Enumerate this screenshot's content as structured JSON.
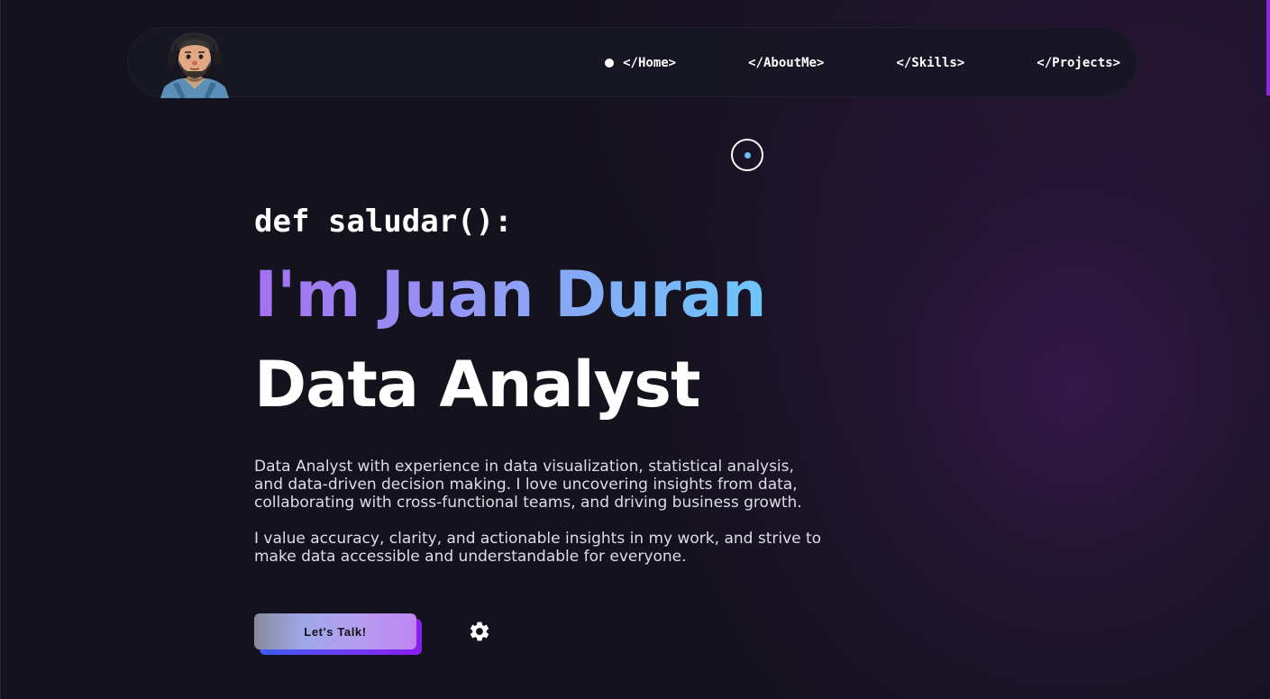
{
  "nav": {
    "items": [
      {
        "label": "</Home>",
        "active": true
      },
      {
        "label": "</AboutMe>",
        "active": false
      },
      {
        "label": "</Skills>",
        "active": false
      },
      {
        "label": "</Projects>",
        "active": false
      }
    ],
    "avatar_icon": "avatar-icon"
  },
  "hero": {
    "greeting": "def saludar():",
    "name": "I'm Juan Duran",
    "role": "Data Analyst",
    "description_1": "Data Analyst with experience in data visualization, statistical analysis, and data-driven decision making. I love uncovering insights from data, collaborating with cross-functional teams, and driving business growth.",
    "description_2": "I value accuracy, clarity, and actionable insights in my work, and strive to make data accessible and understandable for everyone.",
    "cta_label": "Let's Talk!",
    "settings_icon": "gear-icon"
  },
  "colors": {
    "background": "#14121d",
    "navbar": "#181724",
    "accent_purple": "#8a2be2",
    "gradient_start": "#a470f0",
    "gradient_end": "#6cc6f8",
    "cursor_dot": "#6cc0f5"
  }
}
